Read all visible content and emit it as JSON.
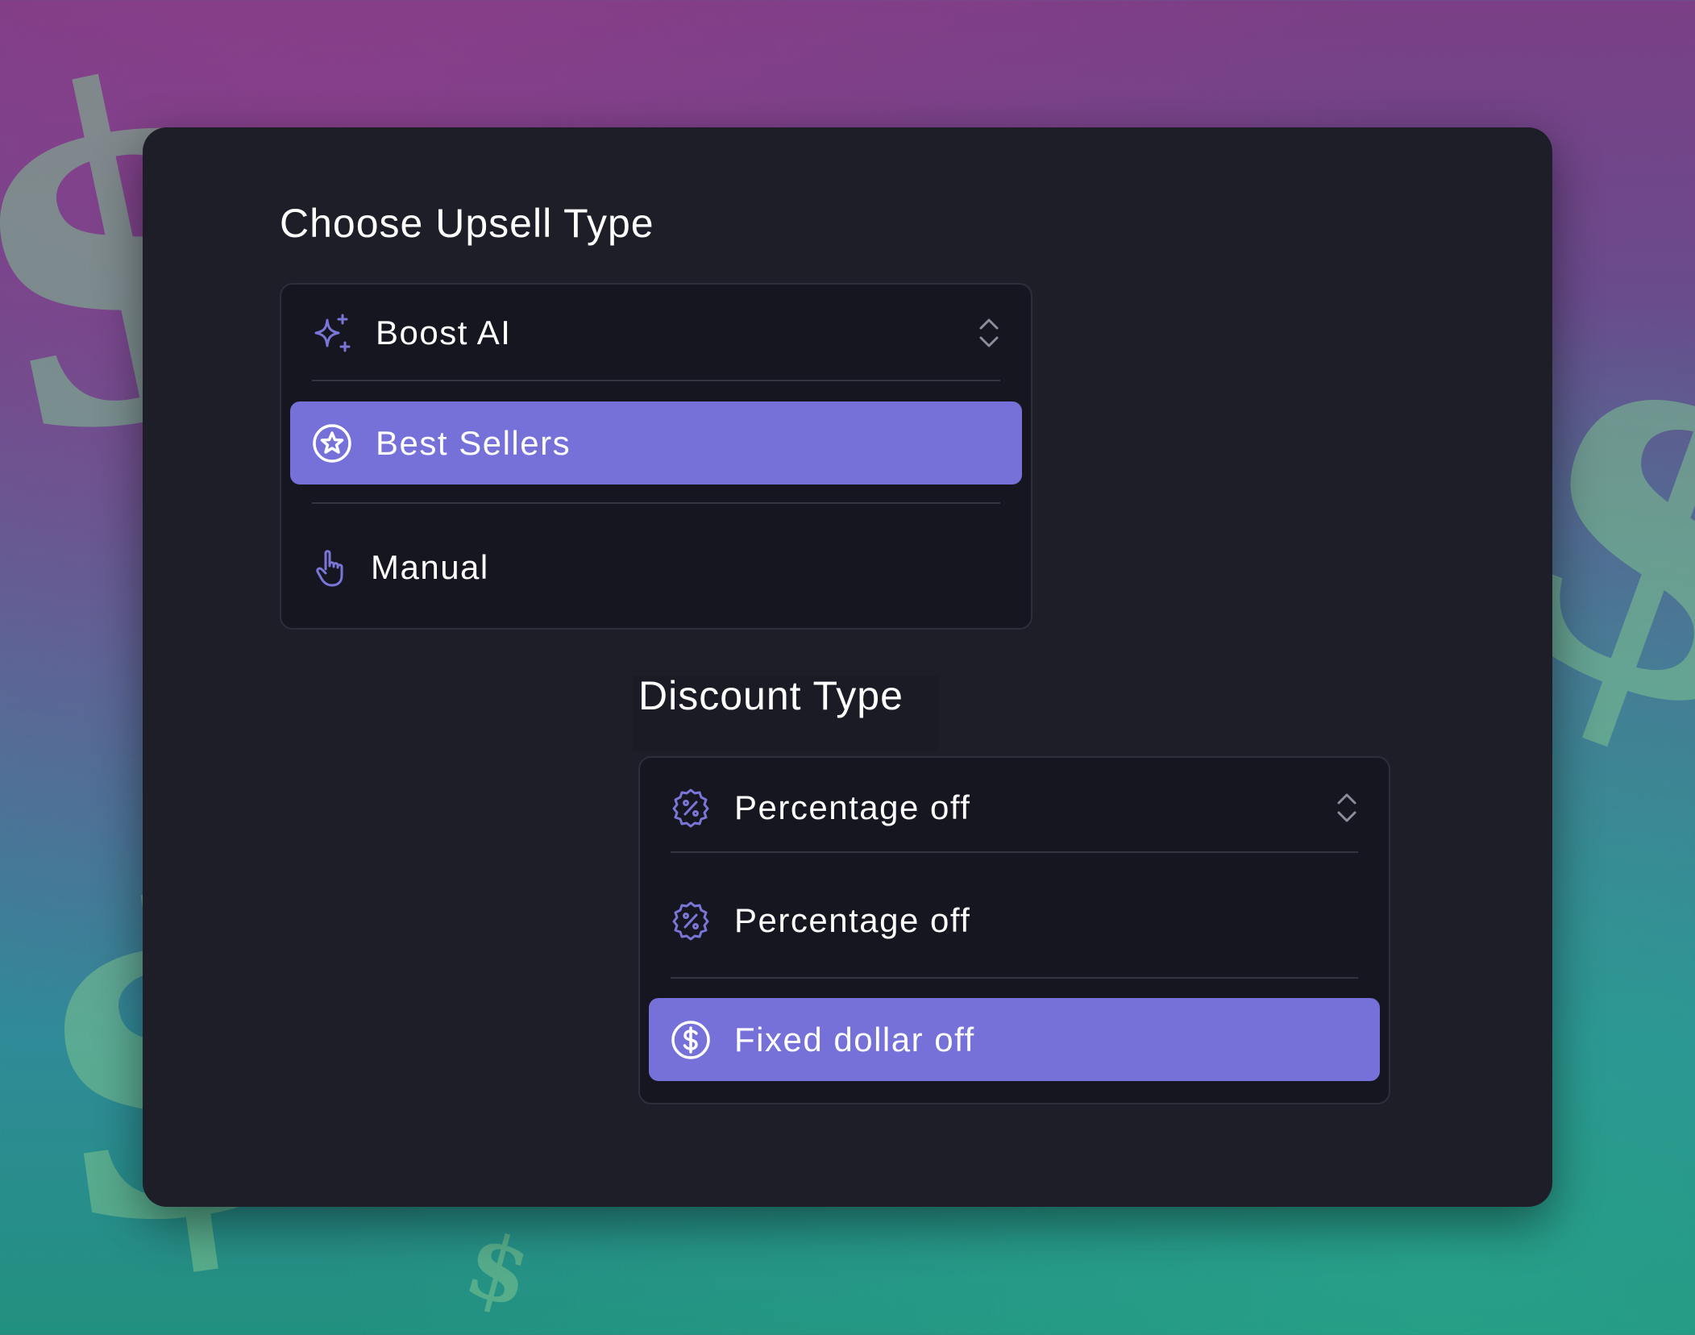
{
  "background": {
    "symbol": "$",
    "colors": {
      "top": "#7a3f86",
      "bottom": "#22907f",
      "symbol": "#7fc490"
    }
  },
  "accent_color": "#7671d8",
  "upsell": {
    "title": "Choose Upsell Type",
    "current": {
      "label": "Boost AI",
      "icon": "sparkles-icon"
    },
    "options": [
      {
        "label": "Best Sellers",
        "icon": "star-badge-icon",
        "selected": true
      },
      {
        "label": "Manual",
        "icon": "hand-pointer-icon",
        "selected": false
      }
    ]
  },
  "discount": {
    "title": "Discount Type",
    "current": {
      "label": "Percentage off",
      "icon": "percent-badge-icon"
    },
    "options": [
      {
        "label": "Percentage off",
        "icon": "percent-badge-icon",
        "selected": false
      },
      {
        "label": "Fixed dollar off",
        "icon": "dollar-circle-icon",
        "selected": true
      }
    ]
  }
}
